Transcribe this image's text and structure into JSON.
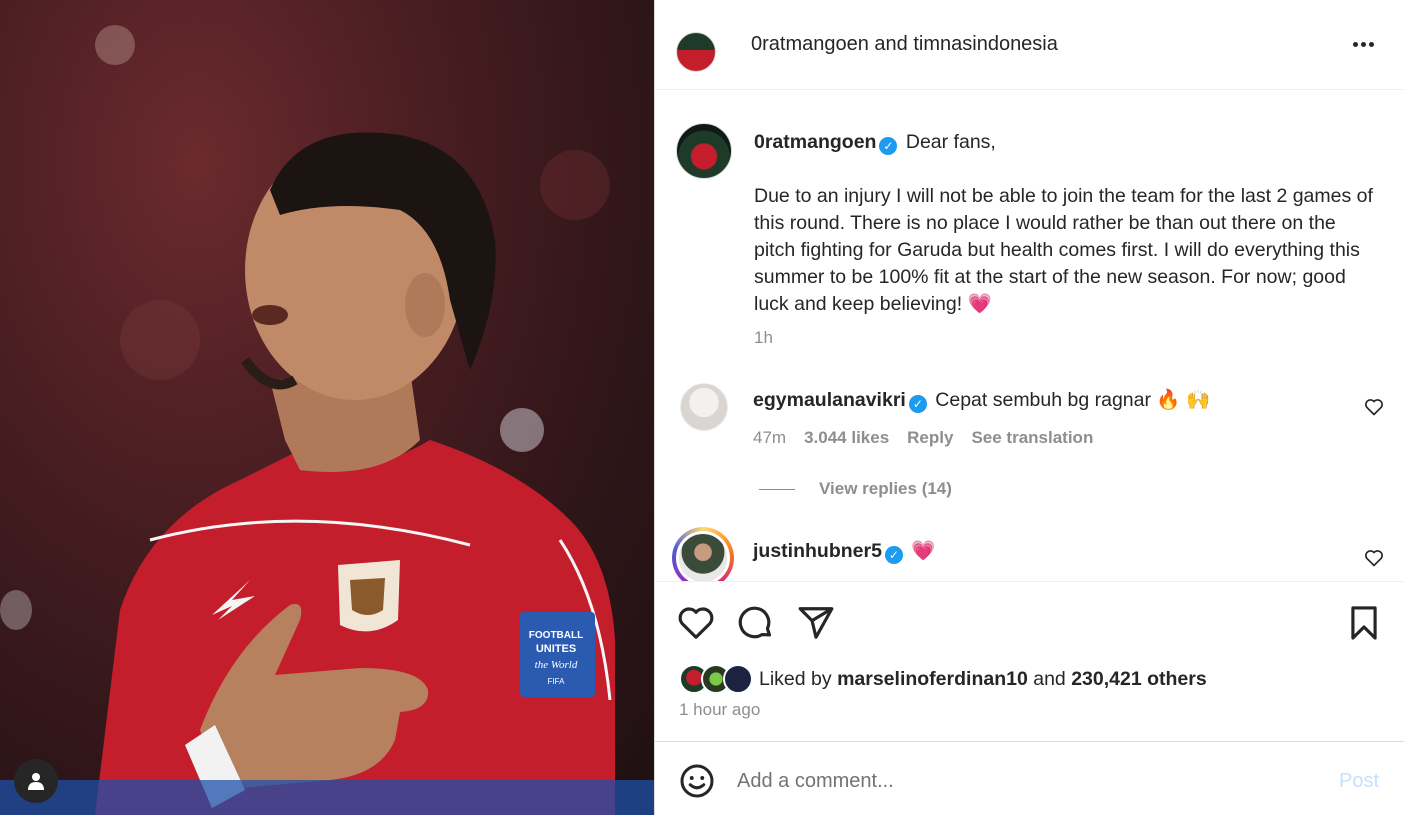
{
  "post": {
    "header": {
      "title": "0ratmangoen and timnasindonesia"
    },
    "caption": {
      "username": "0ratmangoen",
      "greeting": "Dear fans,",
      "body": "Due to an injury I will not be able to join the team for the last 2 games of this round. There is no place I would rather be than out there on the pitch fighting for Garuda but health comes first. I will do everything this summer to be 100% fit at the start of the new season. For now; good luck and keep believing!",
      "emoji": "💗",
      "time": "1h"
    },
    "comments": [
      {
        "username": "egymaulanavikri",
        "text": "Cepat sembuh bg ragnar",
        "emoji": "🔥 🙌",
        "time": "47m",
        "likes": "3.044 likes",
        "reply_label": "Reply",
        "translate_label": "See translation",
        "view_replies": "View replies (14)"
      },
      {
        "username": "justinhubner5",
        "emoji": "💗"
      }
    ],
    "likes": {
      "prefix": "Liked by",
      "user": "marselinoferdinan10",
      "joiner": "and",
      "others": "230,421 others"
    },
    "posted_ago": "1 hour ago",
    "composer": {
      "placeholder": "Add a comment...",
      "post_label": "Post"
    },
    "icons": [
      "more-icon",
      "verified-icon",
      "heart-icon",
      "comment-icon",
      "share-icon",
      "bookmark-icon",
      "emoji-icon",
      "user-tag-icon"
    ],
    "colors": {
      "verified": "#1d9bf0",
      "post_disabled": "#c5e0fc",
      "muted": "#8e8e8e",
      "jersey_red": "#c41e2c"
    }
  }
}
